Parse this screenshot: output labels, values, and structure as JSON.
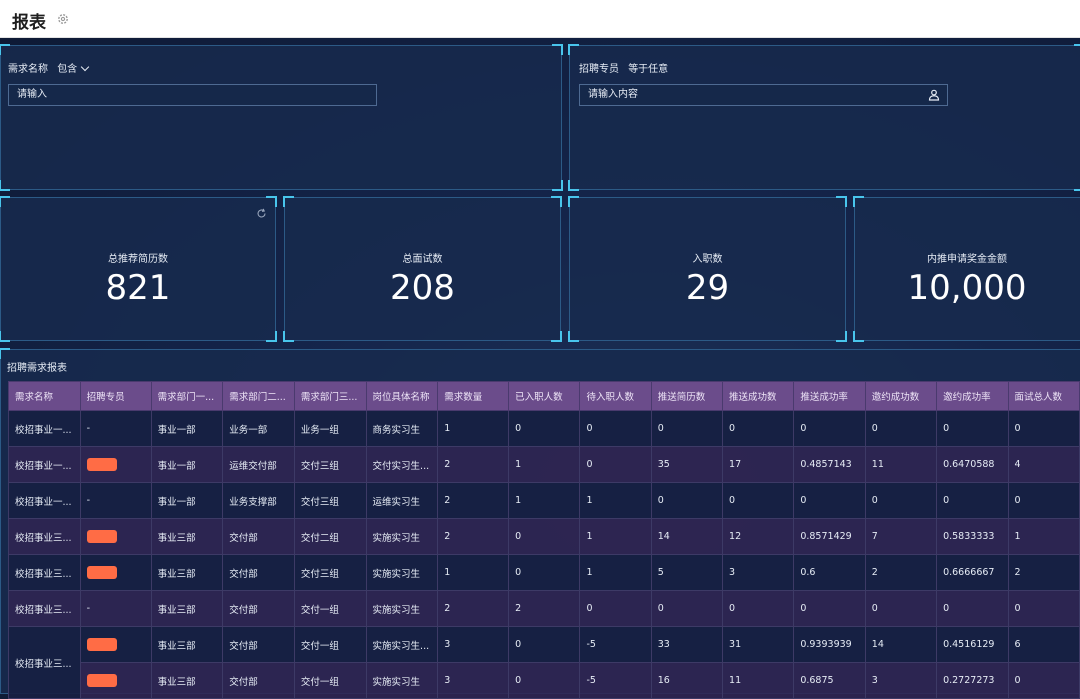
{
  "page": {
    "title": "报表"
  },
  "filters": [
    {
      "label": "需求名称",
      "operator": "包含",
      "placeholder": "请输入"
    },
    {
      "label": "招聘专员",
      "operator": "等于任意",
      "placeholder": "请输入内容"
    }
  ],
  "kpis": [
    {
      "label": "总推荐简历数",
      "value": "821"
    },
    {
      "label": "总面试数",
      "value": "208"
    },
    {
      "label": "入职数",
      "value": "29"
    },
    {
      "label": "内推申请奖金金额",
      "value": "10,000"
    }
  ],
  "report": {
    "title": "招聘需求报表",
    "columns": [
      "需求名称",
      "招聘专员",
      "需求部门一...",
      "需求部门二...",
      "需求部门三...",
      "岗位具体名称",
      "需求数量",
      "已入职人数",
      "待入职人数",
      "推送简历数",
      "推送成功数",
      "推送成功率",
      "邀约成功数",
      "邀约成功率",
      "面试总人数"
    ],
    "rows": [
      [
        "校招事业一...",
        "-",
        "事业一部",
        "业务一部",
        "业务一组",
        "商务实习生",
        "1",
        "0",
        "0",
        "0",
        "0",
        "0",
        "0",
        "0",
        "0"
      ],
      [
        "校招事业一...",
        "",
        "事业一部",
        "运维交付部",
        "交付三组",
        "交付实习生...",
        "2",
        "1",
        "0",
        "35",
        "17",
        "0.4857143",
        "11",
        "0.6470588",
        "4"
      ],
      [
        "校招事业一...",
        "-",
        "事业一部",
        "业务支撑部",
        "交付三组",
        "运维实习生",
        "2",
        "1",
        "1",
        "0",
        "0",
        "0",
        "0",
        "0",
        "0"
      ],
      [
        "校招事业三...",
        "",
        "事业三部",
        "交付部",
        "交付二组",
        "实施实习生",
        "2",
        "0",
        "1",
        "14",
        "12",
        "0.8571429",
        "7",
        "0.5833333",
        "1"
      ],
      [
        "校招事业三...",
        "",
        "事业三部",
        "交付部",
        "交付三组",
        "实施实习生",
        "1",
        "0",
        "1",
        "5",
        "3",
        "0.6",
        "2",
        "0.6666667",
        "2"
      ],
      [
        "校招事业三...",
        "-",
        "事业三部",
        "交付部",
        "交付一组",
        "实施实习生",
        "2",
        "2",
        "0",
        "0",
        "0",
        "0",
        "0",
        "0",
        "0"
      ],
      [
        "校招事业三...",
        "",
        "事业三部",
        "交付部",
        "交付一组",
        "实施实习生...",
        "3",
        "0",
        "-5",
        "33",
        "31",
        "0.9393939",
        "14",
        "0.4516129",
        "6"
      ],
      [
        "",
        "",
        "事业三部",
        "交付部",
        "交付一组",
        "实施实习生",
        "3",
        "0",
        "-5",
        "16",
        "11",
        "0.6875",
        "3",
        "0.2727273",
        "0"
      ]
    ]
  },
  "colors": {
    "accent": "#49c5ec",
    "header": "#6b4c8b",
    "tag": "#ff6c45"
  }
}
